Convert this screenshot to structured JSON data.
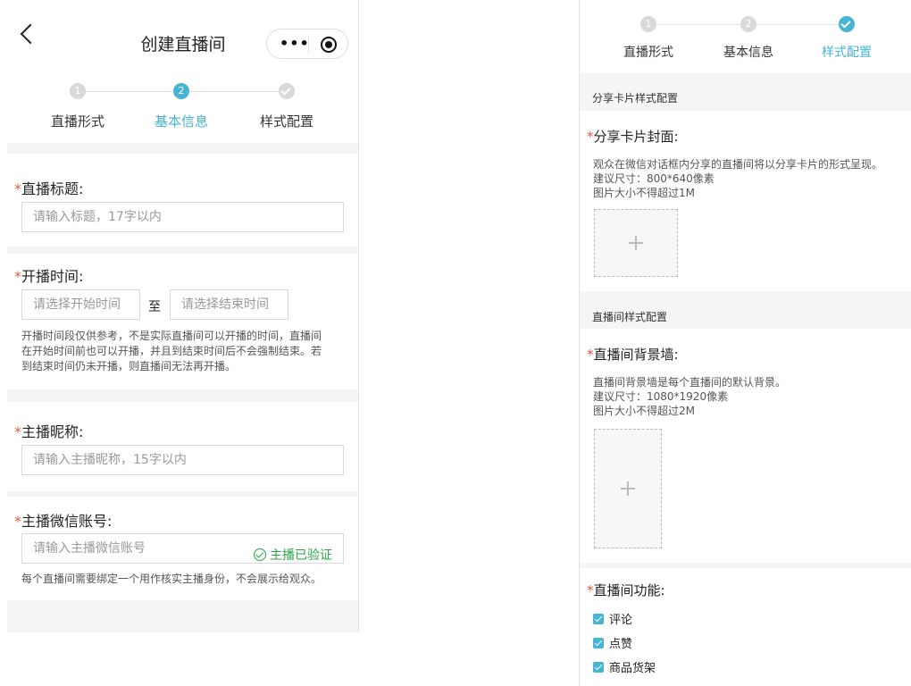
{
  "left": {
    "nav_title": "创建直播间",
    "capsule_dots": "•••",
    "steps": [
      {
        "num": "1",
        "label": "直播形式"
      },
      {
        "num": "2",
        "label": "基本信息"
      },
      {
        "label": "样式配置"
      }
    ],
    "title_field": {
      "required": "*",
      "label": "直播标题:",
      "placeholder": "请输入标题，17字以内"
    },
    "time_field": {
      "required": "*",
      "label": "开播时间:",
      "start_placeholder": "请选择开始时间",
      "to": "至",
      "end_placeholder": "请选择结束时间",
      "hint_lines": [
        "开播时间段仅供参考，不是实际直播间可以开播的时间，直播间",
        "在开始时间前也可以开播，并且到结束时间后不会强制结束。若",
        "到结束时间仍未开播，则直播间无法再开播。"
      ]
    },
    "nickname_field": {
      "required": "*",
      "label": "主播昵称:",
      "placeholder": "请输入主播昵称，15字以内"
    },
    "wechat_field": {
      "required": "*",
      "label": "主播微信账号:",
      "placeholder": "请输入主播微信账号",
      "verified": "主播已验证",
      "hint": "每个直播间需要绑定一个用作核实主播身份，不会展示给观众。"
    }
  },
  "right": {
    "steps": [
      {
        "num": "1",
        "label": "直播形式"
      },
      {
        "num": "2",
        "label": "基本信息"
      },
      {
        "label": "样式配置"
      }
    ],
    "share_section_title": "分享卡片样式配置",
    "share_cover": {
      "required": "*",
      "label": "分享卡片封面:",
      "hint_lines": [
        "观众在微信对话框内分享的直播间将以分享卡片的形式呈现。",
        "建议尺寸：800*640像素",
        "图片大小不得超过1M"
      ]
    },
    "room_section_title": "直播间样式配置",
    "background": {
      "required": "*",
      "label": "直播间背景墙:",
      "hint_lines": [
        "直播间背景墙是每个直播间的默认背景。",
        "建议尺寸：1080*1920像素",
        "图片大小不得超过2M"
      ]
    },
    "functions": {
      "required": "*",
      "label": "直播间功能:",
      "items": [
        "评论",
        "点赞",
        "商品货架"
      ]
    }
  }
}
